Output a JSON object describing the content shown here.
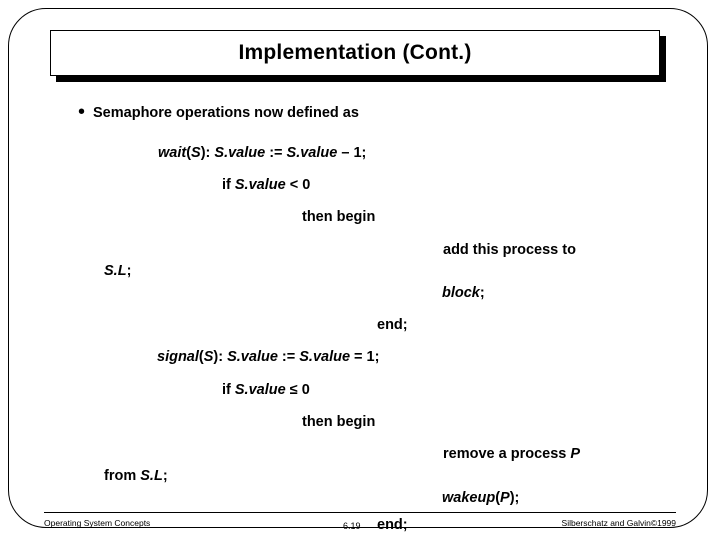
{
  "slide": {
    "title": "Implementation (Cont.)",
    "bullet": {
      "marker": "•",
      "text": "Semaphore operations now defined as"
    },
    "code_lines": [
      {
        "id": "l1",
        "html_parts": [
          {
            "t": "wait",
            "i": true
          },
          {
            "t": "(",
            "i": false
          },
          {
            "t": "S",
            "i": true
          },
          {
            "t": "):  ",
            "i": false
          },
          {
            "t": "S.value",
            "i": true
          },
          {
            "t": " := ",
            "i": false
          },
          {
            "t": "S.value",
            "i": true
          },
          {
            "t": " – 1;",
            "i": false
          }
        ]
      },
      {
        "id": "l2",
        "html_parts": [
          {
            "t": "if ",
            "i": false
          },
          {
            "t": "S.value",
            "i": true
          },
          {
            "t": " < 0",
            "i": false
          }
        ]
      },
      {
        "id": "l3",
        "html_parts": [
          {
            "t": "then begin",
            "i": false
          }
        ]
      },
      {
        "id": "l4",
        "html_parts": [
          {
            "t": "add this process to",
            "i": false
          }
        ]
      },
      {
        "id": "l5",
        "html_parts": [
          {
            "t": "S.L",
            "i": true
          },
          {
            "t": ";",
            "i": false
          }
        ]
      },
      {
        "id": "l6",
        "html_parts": [
          {
            "t": "block",
            "i": true
          },
          {
            "t": ";",
            "i": false
          }
        ]
      },
      {
        "id": "l7",
        "html_parts": [
          {
            "t": "end;",
            "i": false
          }
        ]
      },
      {
        "id": "l8",
        "html_parts": [
          {
            "t": "signal",
            "i": true
          },
          {
            "t": "(",
            "i": false
          },
          {
            "t": "S",
            "i": true
          },
          {
            "t": "): ",
            "i": false
          },
          {
            "t": "S.value",
            "i": true
          },
          {
            "t": " := ",
            "i": false
          },
          {
            "t": "S.value",
            "i": true
          },
          {
            "t": " = 1;",
            "i": false
          }
        ]
      },
      {
        "id": "l9",
        "html_parts": [
          {
            "t": "if ",
            "i": false
          },
          {
            "t": "S.value",
            "i": true
          },
          {
            "t": " ",
            "i": false
          },
          {
            "t": "≤",
            "i": false
          },
          {
            "t": " 0",
            "i": false
          }
        ]
      },
      {
        "id": "l10",
        "html_parts": [
          {
            "t": "then begin",
            "i": false
          }
        ]
      },
      {
        "id": "l11",
        "html_parts": [
          {
            "t": "remove a process ",
            "i": false
          },
          {
            "t": "P",
            "i": true
          }
        ]
      },
      {
        "id": "l12",
        "html_parts": [
          {
            "t": "from ",
            "i": false
          },
          {
            "t": "S.L",
            "i": true
          },
          {
            "t": ";",
            "i": false
          }
        ]
      },
      {
        "id": "l13",
        "html_parts": [
          {
            "t": "wakeup",
            "i": true
          },
          {
            "t": "(",
            "i": false
          },
          {
            "t": "P",
            "i": true
          },
          {
            "t": ");",
            "i": false
          }
        ]
      },
      {
        "id": "l14",
        "html_parts": [
          {
            "t": "end;",
            "i": false
          }
        ]
      }
    ],
    "lines_text": {
      "l1": "wait(S):  S.value := S.value – 1;",
      "l2": "if S.value < 0",
      "l3": "then begin",
      "l4": "add this process to",
      "l5": "S.L;",
      "l6": "block;",
      "l7": "end;",
      "l8": "signal(S): S.value := S.value = 1;",
      "l9": "if S.value ≤ 0",
      "l10": "then begin",
      "l11": "remove a process P",
      "l12": "from S.L;",
      "l13": "wakeup(P);",
      "l14": "end;"
    }
  },
  "footer": {
    "left": "Operating System Concepts",
    "center": "6.19",
    "right": "Silberschatz and  Galvin©1999"
  }
}
